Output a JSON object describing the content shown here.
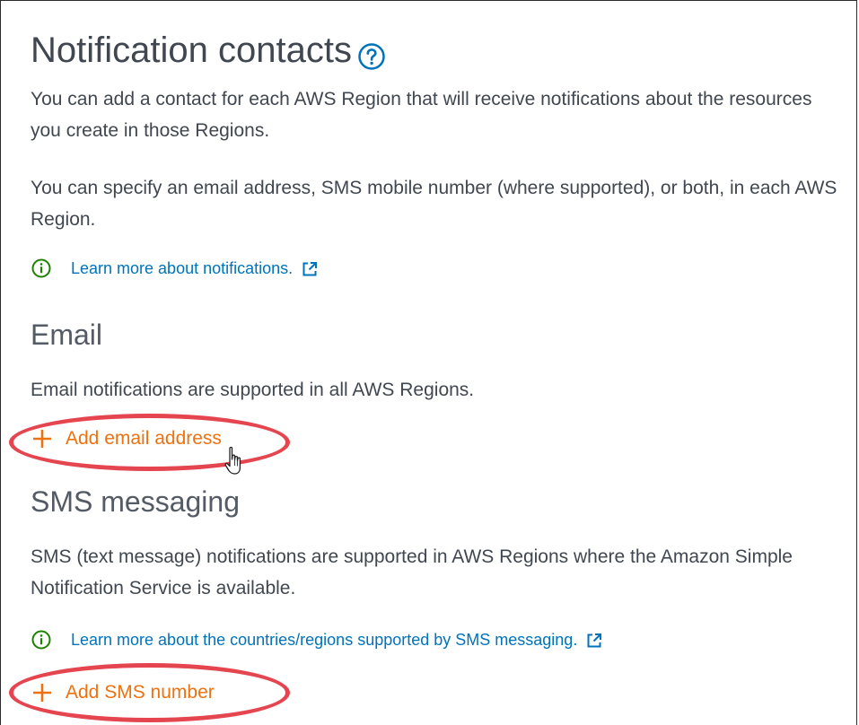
{
  "header": {
    "title": "Notification contacts",
    "help_icon": "help-circle-icon"
  },
  "intro": {
    "paragraph1": "You can add a contact for each AWS Region that will receive notifications about the resources you create in those Regions.",
    "paragraph2": "You can specify an email address, SMS mobile number (where supported), or both, in each AWS Region.",
    "learn_more_link": "Learn more about notifications."
  },
  "email": {
    "title": "Email",
    "description": "Email notifications are supported in all AWS Regions.",
    "add_label": "Add email address"
  },
  "sms": {
    "title": "SMS messaging",
    "description": "SMS (text message) notifications are supported in AWS Regions where the Amazon Simple Notification Service is available.",
    "learn_more_link": "Learn more about the countries/regions supported by SMS messaging.",
    "add_label": "Add SMS number"
  },
  "colors": {
    "link": "#0073bb",
    "action": "#ec7211",
    "info": "#1d8102",
    "highlight": "#e5454f",
    "heading": "#414750"
  },
  "icons": [
    "help-circle-icon",
    "info-icon",
    "external-link-icon",
    "plus-icon",
    "hand-cursor-icon"
  ]
}
